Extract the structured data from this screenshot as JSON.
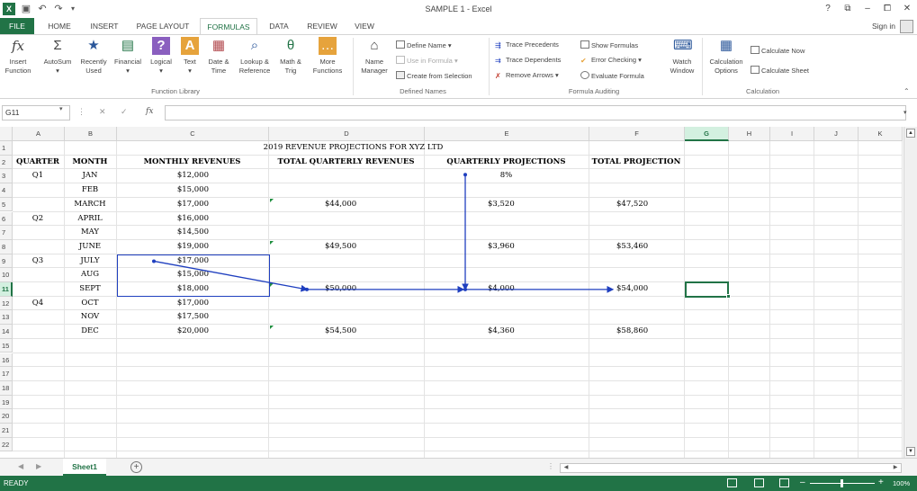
{
  "window": {
    "title": "SAMPLE 1 - Excel"
  },
  "title_controls": [
    "?",
    "⧉",
    "–",
    "⧠",
    "✕"
  ],
  "ribbon_tabs": [
    "FILE",
    "HOME",
    "INSERT",
    "PAGE LAYOUT",
    "FORMULAS",
    "DATA",
    "REVIEW",
    "VIEW"
  ],
  "sign_in": "Sign in",
  "ribbon": {
    "insert_function": [
      "Insert",
      "Function"
    ],
    "autosum": "AutoSum",
    "recently_used": [
      "Recently",
      "Used"
    ],
    "financial": "Financial",
    "logical": "Logical",
    "text": "Text",
    "date_time": [
      "Date &",
      "Time"
    ],
    "lookup_reference": [
      "Lookup &",
      "Reference"
    ],
    "math_trig": [
      "Math &",
      "Trig"
    ],
    "more_functions": [
      "More",
      "Functions"
    ],
    "function_library_label": "Function Library",
    "name_manager": [
      "Name",
      "Manager"
    ],
    "define_name": "Define Name",
    "use_in_formula": "Use in Formula",
    "create_from_selection": "Create from Selection",
    "defined_names_label": "Defined Names",
    "trace_precedents": "Trace Precedents",
    "trace_dependents": "Trace Dependents",
    "remove_arrows": "Remove Arrows",
    "show_formulas": "Show Formulas",
    "error_checking": "Error Checking",
    "evaluate_formula": "Evaluate Formula",
    "watch_window": [
      "Watch",
      "Window"
    ],
    "formula_auditing_label": "Formula Auditing",
    "calculation_options": [
      "Calculation",
      "Options"
    ],
    "calculate_now": "Calculate Now",
    "calculate_sheet": "Calculate Sheet",
    "calculation_label": "Calculation"
  },
  "formula_bar": {
    "name_box": "G11",
    "fx": "fx",
    "formula": ""
  },
  "columns": [
    "A",
    "B",
    "C",
    "D",
    "E",
    "F",
    "G",
    "H",
    "I",
    "J",
    "K"
  ],
  "rows": [
    "1",
    "2",
    "3",
    "4",
    "5",
    "6",
    "7",
    "8",
    "9",
    "10",
    "11",
    "12",
    "13",
    "14",
    "15",
    "16",
    "17",
    "18",
    "19",
    "20",
    "21",
    "22"
  ],
  "sheet": {
    "title": "2019 REVENUE PROJECTIONS FOR XYZ LTD",
    "headers": [
      "QUARTER",
      "MONTH",
      "MONTHLY REVENUES",
      "TOTAL QUARTERLY REVENUES",
      "QUARTERLY PROJECTIONS",
      "TOTAL PROJECTION"
    ],
    "rate": "8%",
    "months": [
      {
        "quarter": "Q1",
        "month": "JAN",
        "revenue": "$12,000",
        "quarterly": "",
        "projection": "",
        "total": ""
      },
      {
        "quarter": "",
        "month": "FEB",
        "revenue": "$15,000",
        "quarterly": "",
        "projection": "",
        "total": ""
      },
      {
        "quarter": "",
        "month": "MARCH",
        "revenue": "$17,000",
        "quarterly": "$44,000",
        "projection": "$3,520",
        "total": "$47,520"
      },
      {
        "quarter": "Q2",
        "month": "APRIL",
        "revenue": "$16,000",
        "quarterly": "",
        "projection": "",
        "total": ""
      },
      {
        "quarter": "",
        "month": "MAY",
        "revenue": "$14,500",
        "quarterly": "",
        "projection": "",
        "total": ""
      },
      {
        "quarter": "",
        "month": "JUNE",
        "revenue": "$19,000",
        "quarterly": "$49,500",
        "projection": "$3,960",
        "total": "$53,460"
      },
      {
        "quarter": "Q3",
        "month": "JULY",
        "revenue": "$17,000",
        "quarterly": "",
        "projection": "",
        "total": ""
      },
      {
        "quarter": "",
        "month": "AUG",
        "revenue": "$15,000",
        "quarterly": "",
        "projection": "",
        "total": ""
      },
      {
        "quarter": "",
        "month": "SEPT",
        "revenue": "$18,000",
        "quarterly": "$50,000",
        "projection": "$4,000",
        "total": "$54,000"
      },
      {
        "quarter": "Q4",
        "month": "OCT",
        "revenue": "$17,000",
        "quarterly": "",
        "projection": "",
        "total": ""
      },
      {
        "quarter": "",
        "month": "NOV",
        "revenue": "$17,500",
        "quarterly": "",
        "projection": "",
        "total": ""
      },
      {
        "quarter": "",
        "month": "DEC",
        "revenue": "$20,000",
        "quarterly": "$54,500",
        "projection": "$4,360",
        "total": "$58,860"
      }
    ]
  },
  "sheet_tabs": [
    "Sheet1"
  ],
  "add_sheet": "+",
  "status": {
    "text": "READY",
    "zoom": "100%"
  },
  "colors": {
    "excel_green": "#217346",
    "trace_arrow": "#1f3fbf"
  }
}
